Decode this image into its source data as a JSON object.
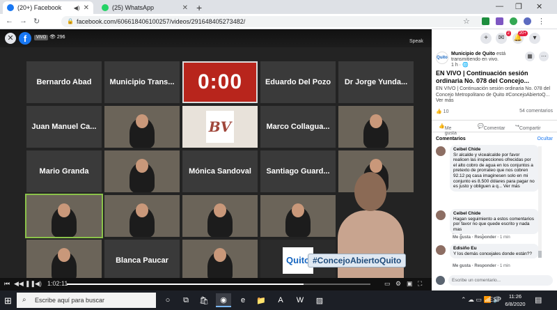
{
  "browser": {
    "tabs": [
      {
        "title": "(20+) Facebook",
        "fav_color": "#1877f2",
        "active": true
      },
      {
        "title": "(25) WhatsApp",
        "fav_color": "#25d366",
        "active": false
      }
    ],
    "new_tab": "+",
    "url": "facebook.com/606618406100257/videos/291648405273482/"
  },
  "video": {
    "close": "✕",
    "live_badge": "VIVO",
    "viewers": "👁 296",
    "speaker_view": "Speak",
    "timer": "0:00",
    "hashtag": "#ConcejoAbiertoQuito",
    "time": "1:02:11",
    "progress_fraction": 0.78,
    "tiles": [
      {
        "label": "Bernardo Abad",
        "kind": "name",
        "col": 0,
        "row": 0
      },
      {
        "label": "Municipio Trans...",
        "kind": "name",
        "col": 1,
        "row": 0
      },
      {
        "label": "0:00",
        "kind": "timer",
        "col": 2,
        "row": 0
      },
      {
        "label": "Eduardo Del Pozo",
        "kind": "name",
        "col": 3,
        "row": 0
      },
      {
        "label": "Dr Jorge Yunda...",
        "kind": "name",
        "col": 4,
        "row": 0
      },
      {
        "label": "Juan Manuel Ca...",
        "kind": "name",
        "col": 0,
        "row": 1
      },
      {
        "label": "",
        "kind": "video",
        "col": 1,
        "row": 1
      },
      {
        "label": "BV",
        "kind": "logo",
        "col": 2,
        "row": 1
      },
      {
        "label": "Marco Collagua...",
        "kind": "name",
        "col": 3,
        "row": 1
      },
      {
        "label": "",
        "kind": "video",
        "col": 4,
        "row": 1
      },
      {
        "label": "Mario Granda",
        "kind": "name",
        "col": 0,
        "row": 2
      },
      {
        "label": "",
        "kind": "video",
        "col": 1,
        "row": 2
      },
      {
        "label": "Mónica Sandoval",
        "kind": "name",
        "col": 2,
        "row": 2
      },
      {
        "label": "Santiago Guard...",
        "kind": "name",
        "col": 3,
        "row": 2
      },
      {
        "label": "",
        "kind": "video",
        "col": 4,
        "row": 2
      },
      {
        "label": "",
        "kind": "video-hl",
        "col": 0,
        "row": 3
      },
      {
        "label": "",
        "kind": "video",
        "col": 1,
        "row": 3
      },
      {
        "label": "",
        "kind": "video",
        "col": 2,
        "row": 3
      },
      {
        "label": "",
        "kind": "video",
        "col": 3,
        "row": 3
      },
      {
        "label": "",
        "kind": "video",
        "col": 0,
        "row": 4
      },
      {
        "label": "Blanca Paucar",
        "kind": "name",
        "col": 1,
        "row": 4
      },
      {
        "label": "",
        "kind": "video",
        "col": 2,
        "row": 4
      },
      {
        "label": "Quito",
        "kind": "quito",
        "col": 3,
        "row": 4
      }
    ]
  },
  "panel": {
    "notif_count": "2",
    "messages_count": "20+",
    "page_name": "Municipio de Quito",
    "page_status": " está transmitiendo en vivo.",
    "page_time": "1 h · 🌐",
    "post_title": "EN VIVO | Continuación sesión ordinaria No. 078 del Concejo...",
    "post_desc": "EN VIVO | Continuación sesión ordinaria No. 078 del Concejo Metropolitano de Quito #ConcejoAbiertoQ...",
    "see_more": "Ver más",
    "reactions": "10",
    "comments_count": "54 comentarios",
    "like": "Me gusta",
    "comment": "Comentar",
    "share": "Compartir",
    "comments_header": "Comentarios",
    "hide": "Ocultar",
    "comments": [
      {
        "author": "Ceibel Chide",
        "text": "Sr alcalde y vicealcalde por favor realicen las inspecciones ofrecidas por el alto cobro de agua en los conjuntos a pretexto de prorrateo que nos cobren 92.12 pq casa imaginesen solo en mi conjunto es 8.500 dólares para pagar no es justo y obliguen a q... Ver más",
        "meta_like": "Me gusta",
        "meta_reply": "Responder",
        "meta_time": "2 min"
      },
      {
        "author": "Ceibel Chide",
        "text": "Hagan seguimiento a estos comentarios por favor no que quede escrito y nada mas",
        "meta_like": "Me gusta",
        "meta_reply": "Responder",
        "meta_time": "1 min"
      },
      {
        "author": "Edisiño Eu",
        "text": "Y los demás concejales donde están??",
        "meta_like": "Me gusta",
        "meta_reply": "Responder",
        "meta_time": "1 min"
      }
    ],
    "comment_placeholder": "Escribe un comentario..."
  },
  "taskbar": {
    "search_placeholder": "Escribe aquí para buscar",
    "lang": "ESP",
    "time": "11:26",
    "date": "6/8/2020"
  }
}
